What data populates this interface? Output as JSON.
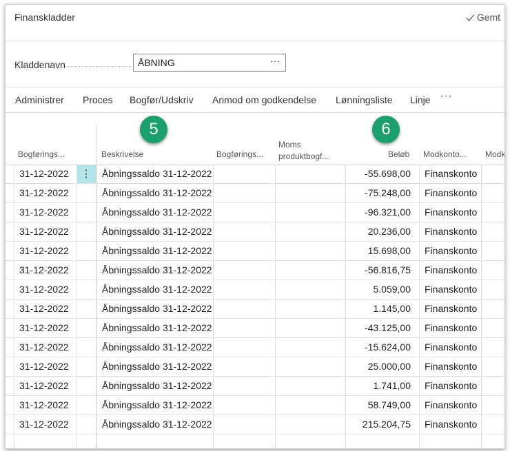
{
  "header": {
    "title": "Finanskladder",
    "saved_label": "Gemt"
  },
  "journal": {
    "label": "Kladdenavn",
    "value": "ÅBNING",
    "more_label": "···"
  },
  "actions": [
    {
      "label": "Administrer"
    },
    {
      "label": "Proces"
    },
    {
      "label": "Bogfør/Udskriv"
    },
    {
      "label": "Anmod om godkendelse"
    },
    {
      "label": "Lønningsliste"
    },
    {
      "label": "Linje"
    }
  ],
  "actions_more": "···",
  "columns": {
    "posting_date": "Bogførings...",
    "description": "Beskrivelse",
    "posting_type": "Bogførings...",
    "vat_line1": "Moms",
    "vat_line2": "produktbogf...",
    "amount": "Beløb",
    "bal_account_type": "Modkonto...",
    "bal_account_no": "Modk"
  },
  "badges": {
    "description": "5",
    "amount": "6"
  },
  "row_menu_icon": "⋮",
  "rows": [
    {
      "date": "31-12-2022",
      "description": "Åbningssaldo 31-12-2022",
      "amount": "-55.698,00",
      "bal_type": "Finanskonto"
    },
    {
      "date": "31-12-2022",
      "description": "Åbningssaldo 31-12-2022",
      "amount": "-75.248,00",
      "bal_type": "Finanskonto"
    },
    {
      "date": "31-12-2022",
      "description": "Åbningssaldo 31-12-2022",
      "amount": "-96.321,00",
      "bal_type": "Finanskonto"
    },
    {
      "date": "31-12-2022",
      "description": "Åbningssaldo 31-12-2022",
      "amount": "20.236,00",
      "bal_type": "Finanskonto"
    },
    {
      "date": "31-12-2022",
      "description": "Åbningssaldo 31-12-2022",
      "amount": "15.698,00",
      "bal_type": "Finanskonto"
    },
    {
      "date": "31-12-2022",
      "description": "Åbningssaldo 31-12-2022",
      "amount": "-56.816,75",
      "bal_type": "Finanskonto"
    },
    {
      "date": "31-12-2022",
      "description": "Åbningssaldo 31-12-2022",
      "amount": "5.059,00",
      "bal_type": "Finanskonto"
    },
    {
      "date": "31-12-2022",
      "description": "Åbningssaldo 31-12-2022",
      "amount": "1.145,00",
      "bal_type": "Finanskonto"
    },
    {
      "date": "31-12-2022",
      "description": "Åbningssaldo 31-12-2022",
      "amount": "-43.125,00",
      "bal_type": "Finanskonto"
    },
    {
      "date": "31-12-2022",
      "description": "Åbningssaldo 31-12-2022",
      "amount": "-15.624,00",
      "bal_type": "Finanskonto"
    },
    {
      "date": "31-12-2022",
      "description": "Åbningssaldo 31-12-2022",
      "amount": "25.000,00",
      "bal_type": "Finanskonto"
    },
    {
      "date": "31-12-2022",
      "description": "Åbningssaldo 31-12-2022",
      "amount": "1.741,00",
      "bal_type": "Finanskonto"
    },
    {
      "date": "31-12-2022",
      "description": "Åbningssaldo 31-12-2022",
      "amount": "58.749,00",
      "bal_type": "Finanskonto"
    },
    {
      "date": "31-12-2022",
      "description": "Åbningssaldo 31-12-2022",
      "amount": "215.204,75",
      "bal_type": "Finanskonto"
    }
  ],
  "colors": {
    "accent": "#0e8a8a",
    "badge": "#1aa06d",
    "selected_cell": "#b3e4ea"
  }
}
